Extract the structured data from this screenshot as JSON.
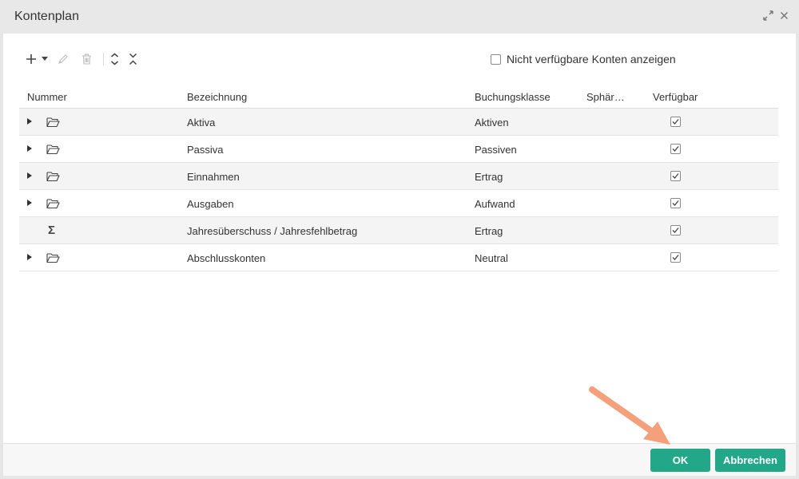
{
  "window": {
    "title": "Kontenplan",
    "icons": {
      "expand": "expand-icon",
      "close": "close-icon"
    }
  },
  "toolbar": {
    "add_icon": "plus-icon",
    "add_dropdown_icon": "caret-down-icon",
    "edit_icon": "pencil-icon",
    "delete_icon": "trash-icon",
    "expand_all_icon": "expand-all-icon",
    "collapse_all_icon": "collapse-all-icon",
    "show_unavailable_label": "Nicht verfügbare Konten anzeigen",
    "show_unavailable_checked": false
  },
  "grid": {
    "columns": [
      "Nummer",
      "Bezeichnung",
      "Buchungsklasse",
      "Sphär…",
      "Verfügbar"
    ],
    "rows": [
      {
        "icon": "folder-icon",
        "expandable": true,
        "bezeichnung": "Aktiva",
        "buchungsklasse": "Aktiven",
        "sphaere": "",
        "verfuegbar": true
      },
      {
        "icon": "folder-icon",
        "expandable": true,
        "bezeichnung": "Passiva",
        "buchungsklasse": "Passiven",
        "sphaere": "",
        "verfuegbar": true
      },
      {
        "icon": "folder-icon",
        "expandable": true,
        "bezeichnung": "Einnahmen",
        "buchungsklasse": "Ertrag",
        "sphaere": "",
        "verfuegbar": true
      },
      {
        "icon": "folder-icon",
        "expandable": true,
        "bezeichnung": "Ausgaben",
        "buchungsklasse": "Aufwand",
        "sphaere": "",
        "verfuegbar": true
      },
      {
        "icon": "sigma-icon",
        "expandable": false,
        "bezeichnung": "Jahresüberschuss / Jahresfehlbetrag",
        "buchungsklasse": "Ertrag",
        "sphaere": "",
        "verfuegbar": true
      },
      {
        "icon": "folder-icon",
        "expandable": true,
        "bezeichnung": "Abschlusskonten",
        "buchungsklasse": "Neutral",
        "sphaere": "",
        "verfuegbar": true
      }
    ]
  },
  "footer": {
    "ok_label": "OK",
    "cancel_label": "Abbrechen"
  },
  "colors": {
    "primary_button": "#22a789",
    "highlight_arrow": "#f4a07c"
  }
}
